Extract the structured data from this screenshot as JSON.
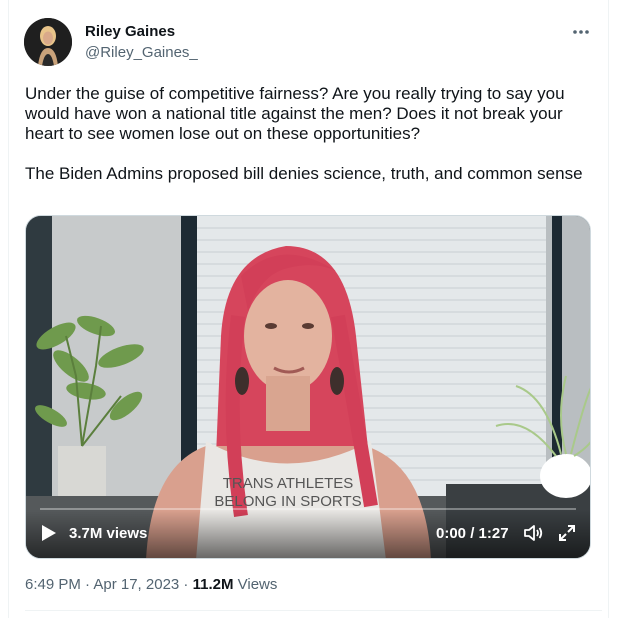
{
  "author": {
    "name": "Riley Gaines",
    "handle": "@Riley_Gaines_"
  },
  "tweet": {
    "text": "Under the guise of competitive fairness? Are you really trying to say you would have won a national title against the men? Does it not break your heart to see women lose out on these opportunities?\n\nThe Biden Admins proposed bill denies science, truth, and common sense"
  },
  "video": {
    "views": "3.7M views",
    "time": "0:00 / 1:27",
    "shirt_line1": "TRANS ATHLETES",
    "shirt_line2": "BELONG IN SPORTS",
    "progress": 0
  },
  "meta": {
    "timestamp": "6:49 PM · Apr 17, 2023 · ",
    "view_count": "11.2M",
    "views_label": " Views"
  },
  "icons": {
    "more": "more-horizontal-icon",
    "play": "play-icon",
    "volume": "volume-icon",
    "fullscreen": "fullscreen-icon"
  },
  "colors": {
    "text_primary": "#0f1419",
    "text_secondary": "#536471",
    "border": "#cfd9de"
  }
}
